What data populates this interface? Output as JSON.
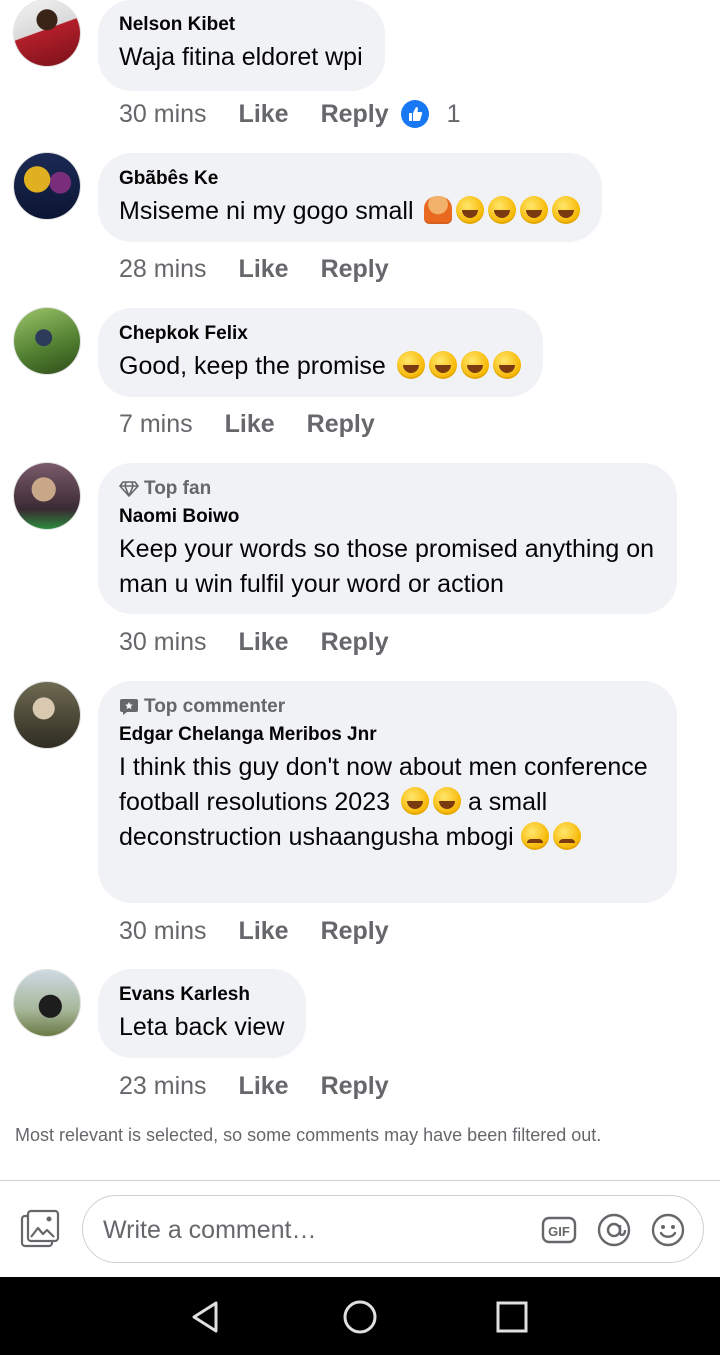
{
  "comments": [
    {
      "name": "Nelson Kibet",
      "text": "Waja fitina eldoret wpi",
      "time": "30 mins",
      "like": "Like",
      "reply": "Reply",
      "reactions": "1"
    },
    {
      "name": "Gbãbês Ke",
      "text": "Msiseme ni my gogo small",
      "time": "28 mins",
      "like": "Like",
      "reply": "Reply"
    },
    {
      "name": "Chepkok Felix",
      "text": "Good, keep the promise",
      "time": "7 mins",
      "like": "Like",
      "reply": "Reply"
    },
    {
      "badge": "Top fan",
      "name": "Naomi Boiwo",
      "text": "Keep your words so those promised anything on man u win fulfil your word or action",
      "time": "30 mins",
      "like": "Like",
      "reply": "Reply"
    },
    {
      "badge": "Top commenter",
      "name": "Edgar Chelanga Meribos Jnr",
      "text_a": "I think this guy don't now about men conference football resolutions 2023",
      "text_b": "a small deconstruction ushaangusha mbogi",
      "time": "30 mins",
      "like": "Like",
      "reply": "Reply"
    },
    {
      "name": "Evans Karlesh",
      "text": "Leta back view",
      "time": "23 mins",
      "like": "Like",
      "reply": "Reply"
    }
  ],
  "filter_note": "Most relevant is selected, so some comments may have been filtered out.",
  "composer": {
    "placeholder": "Write a comment…",
    "icons": [
      "photo-icon",
      "gif-icon",
      "mention-icon",
      "emoji-icon"
    ]
  },
  "nav": {
    "icons": [
      "back-icon",
      "home-icon",
      "recents-icon"
    ]
  },
  "colors": {
    "bubble": "#f0f2f5",
    "meta_text": "#65676b",
    "like_blue": "#1877f2",
    "nav_bar": "#000000"
  }
}
